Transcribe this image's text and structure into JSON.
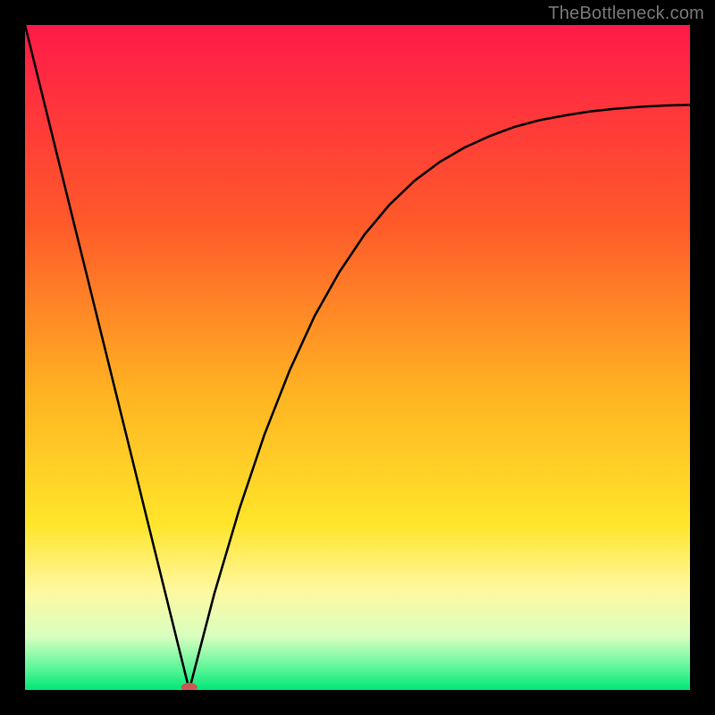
{
  "watermark": "TheBottleneck.com",
  "chart_data": {
    "type": "line",
    "title": "",
    "xlabel": "",
    "ylabel": "",
    "xlim": [
      0,
      100
    ],
    "ylim": [
      0,
      100
    ],
    "minimum_x": 24.7,
    "background_gradient": {
      "stops": [
        {
          "offset": 0.0,
          "color": "#ff1a48"
        },
        {
          "offset": 0.3,
          "color": "#ff5a2a"
        },
        {
          "offset": 0.55,
          "color": "#ffb222"
        },
        {
          "offset": 0.75,
          "color": "#ffe52a"
        },
        {
          "offset": 0.85,
          "color": "#fff8a0"
        },
        {
          "offset": 0.92,
          "color": "#d8ffc0"
        },
        {
          "offset": 0.97,
          "color": "#55f596"
        },
        {
          "offset": 1.0,
          "color": "#00e676"
        }
      ]
    },
    "marker": {
      "x": 24.7,
      "y": 0,
      "rx": 9,
      "ry": 5,
      "color": "#c9594f"
    },
    "series": [
      {
        "name": "left-branch",
        "x": [
          0.0,
          3.09,
          6.17,
          9.26,
          12.35,
          15.44,
          18.52,
          21.61,
          24.7
        ],
        "values": [
          100.0,
          87.5,
          75.0,
          62.5,
          50.0,
          37.5,
          25.0,
          12.5,
          0.0
        ]
      },
      {
        "name": "right-branch",
        "x": [
          24.7,
          28.47,
          32.23,
          36.0,
          39.77,
          43.53,
          47.3,
          51.06,
          54.83,
          58.6,
          62.36,
          66.13,
          69.89,
          73.66,
          77.43,
          81.19,
          84.96,
          88.72,
          92.49,
          96.26,
          100.0
        ],
        "values": [
          0.0,
          14.5,
          27.2,
          38.4,
          48.0,
          56.2,
          62.9,
          68.5,
          73.0,
          76.6,
          79.4,
          81.6,
          83.3,
          84.7,
          85.7,
          86.4,
          87.0,
          87.4,
          87.7,
          87.9,
          88.0
        ]
      }
    ]
  }
}
